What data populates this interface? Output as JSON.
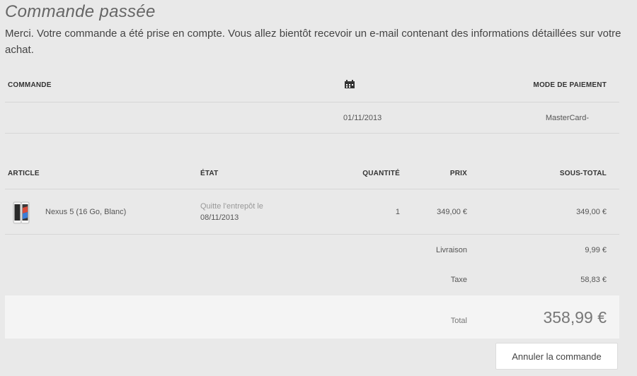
{
  "header": {
    "title": "Commande passée",
    "intro": "Merci. Votre commande a été prise en compte. Vous allez bientôt recevoir un e-mail contenant des informations détaillées sur votre achat."
  },
  "order_table": {
    "col_order": "COMMANDE",
    "date_icon": "calendar-icon",
    "col_payment": "MODE DE PAIEMENT",
    "order_number": "",
    "date": "01/11/2013",
    "payment_method": "MasterCard-"
  },
  "items_table": {
    "col_article": "ARTICLE",
    "col_status": "ÉTAT",
    "col_quantity": "QUANTITÉ",
    "col_price": "PRIX",
    "col_subtotal": "SOUS-TOTAL",
    "item": {
      "name": "Nexus 5 (16 Go, Blanc)",
      "status_label": "Quitte l'entrepôt le",
      "status_date": "08/11/2013",
      "quantity": "1",
      "price": "349,00 €",
      "subtotal": "349,00 €"
    }
  },
  "summary": {
    "shipping_label": "Livraison",
    "shipping_value": "9,99 €",
    "tax_label": "Taxe",
    "tax_value": "58,83 €",
    "total_label": "Total",
    "total_value": "358,99 €"
  },
  "actions": {
    "cancel_label": "Annuler la commande"
  }
}
